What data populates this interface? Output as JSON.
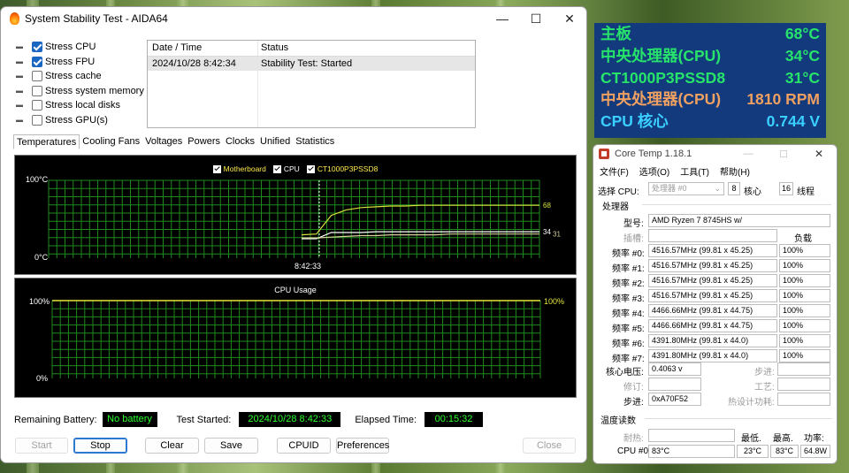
{
  "aida": {
    "title": "System Stability Test - AIDA64",
    "options": [
      {
        "label": "Stress CPU",
        "checked": true,
        "icon": "cpu-icon"
      },
      {
        "label": "Stress FPU",
        "checked": true,
        "icon": "fpu-icon"
      },
      {
        "label": "Stress cache",
        "checked": false,
        "icon": "cache-icon"
      },
      {
        "label": "Stress system memory",
        "checked": false,
        "icon": "memory-icon"
      },
      {
        "label": "Stress local disks",
        "checked": false,
        "icon": "disk-icon"
      },
      {
        "label": "Stress GPU(s)",
        "checked": false,
        "icon": "gpu-icon"
      }
    ],
    "log": {
      "headers": [
        "Date / Time",
        "Status"
      ],
      "rows": [
        [
          "2024/10/28 8:42:34",
          "Stability Test: Started"
        ]
      ]
    },
    "tabs": [
      "Temperatures",
      "Cooling Fans",
      "Voltages",
      "Powers",
      "Clocks",
      "Unified",
      "Statistics"
    ],
    "temp_legend": [
      "Motherboard",
      "CPU",
      "CT1000P3PSSD8"
    ],
    "temp_top": "100°C",
    "temp_bottom": "0°C",
    "temp_time": "8:42:33",
    "cpu_title": "CPU Usage",
    "cpu_top": "100%",
    "cpu_bottom": "0%",
    "remaining_battery_label": "Remaining Battery:",
    "remaining_battery_value": "No battery",
    "test_started_label": "Test Started:",
    "test_started_value": "2024/10/28 8:42:33",
    "elapsed_label": "Elapsed Time:",
    "elapsed_value": "00:15:32",
    "buttons": {
      "start": "Start",
      "stop": "Stop",
      "clear": "Clear",
      "save": "Save",
      "cpuid": "CPUID",
      "preferences": "Preferences",
      "close": "Close"
    }
  },
  "chart_data": [
    {
      "type": "line",
      "ylim": [
        0,
        100
      ],
      "series": [
        {
          "name": "Motherboard",
          "end_label": "68",
          "values": [
            30,
            31,
            55,
            62,
            65,
            66,
            67,
            67,
            68,
            68,
            68,
            68,
            68,
            68,
            68,
            68,
            68
          ]
        },
        {
          "name": "CPU",
          "end_label": "34",
          "values": [
            25,
            25,
            33,
            33,
            33,
            34,
            34,
            34,
            34,
            34,
            34,
            34,
            34,
            34,
            34,
            34,
            34
          ]
        },
        {
          "name": "CT1000P3PSSD8",
          "end_label": "31",
          "values": [
            26,
            26,
            27,
            28,
            29,
            29,
            30,
            30,
            30,
            30,
            31,
            31,
            31,
            31,
            31,
            31,
            31
          ]
        }
      ],
      "colors": {
        "Motherboard": "#d8e23a",
        "CPU": "#ffffff",
        "CT1000P3PSSD8": "#d8d39a"
      }
    },
    {
      "type": "line",
      "title": "CPU Usage",
      "ylim": [
        0,
        100
      ],
      "series": [
        {
          "end_label": "100%",
          "values": [
            100,
            100
          ]
        }
      ],
      "colors": {
        "usage": "#e6e63a"
      }
    }
  ],
  "osd": [
    {
      "label": "主板",
      "value": "68°C",
      "color": "#27e36a"
    },
    {
      "label": "中央处理器(CPU)",
      "value": "34°C",
      "color": "#27e36a"
    },
    {
      "label": "CT1000P3PSSD8",
      "value": "31°C",
      "color": "#27e36a"
    },
    {
      "label": "中央处理器(CPU)",
      "value": "1810 RPM",
      "color": "#f0a060"
    },
    {
      "label": "CPU 核心",
      "value": "0.744 V",
      "color": "#3ad0ff"
    }
  ],
  "coretemp": {
    "title": "Core Temp 1.18.1",
    "menu": [
      "文件(F)",
      "选项(O)",
      "工具(T)",
      "帮助(H)"
    ],
    "select_cpu_label": "选择 CPU:",
    "select_cpu_value": "处理器 #0",
    "cores_value": "8",
    "cores_label": "核心",
    "threads_value": "16",
    "threads_label": "线程",
    "processor_label": "处理器",
    "model_label": "型号:",
    "model_value": "AMD Ryzen 7 8745HS w/",
    "platform_label": "插槽:",
    "load_label": "负载",
    "freqs": [
      {
        "label": "频率 #0:",
        "value": "4516.57MHz (99.81 x 45.25)",
        "load": "100%"
      },
      {
        "label": "频率 #1:",
        "value": "4516.57MHz (99.81 x 45.25)",
        "load": "100%"
      },
      {
        "label": "频率 #2:",
        "value": "4516.57MHz (99.81 x 45.25)",
        "load": "100%"
      },
      {
        "label": "频率 #3:",
        "value": "4516.57MHz (99.81 x 45.25)",
        "load": "100%"
      },
      {
        "label": "频率 #4:",
        "value": "4466.66MHz (99.81 x 44.75)",
        "load": "100%"
      },
      {
        "label": "频率 #5:",
        "value": "4466.66MHz (99.81 x 44.75)",
        "load": "100%"
      },
      {
        "label": "频率 #6:",
        "value": "4391.80MHz (99.81 x 44.0)",
        "load": "100%"
      },
      {
        "label": "频率 #7:",
        "value": "4391.80MHz (99.81 x 44.0)",
        "load": "100%"
      }
    ],
    "vid_label": "核心电压:",
    "vid_value": "0.4063 v",
    "modulation_label": "步进:",
    "revision_label": "修订:",
    "lithography_label": "工艺:",
    "cpuid_label": "步进:",
    "cpuid_value": "0xA70F52",
    "tdp_label": "热设计功耗:",
    "temps_label": "温度读数",
    "tjmax_label": "耐热:",
    "min_label": "最低.",
    "max_label": "最高.",
    "power_label": "功率:",
    "cpu0_label": "CPU #0:",
    "cpu0_temp": "83°C",
    "cpu0_min": "23°C",
    "cpu0_max": "83°C",
    "cpu0_power": "64.8W"
  }
}
